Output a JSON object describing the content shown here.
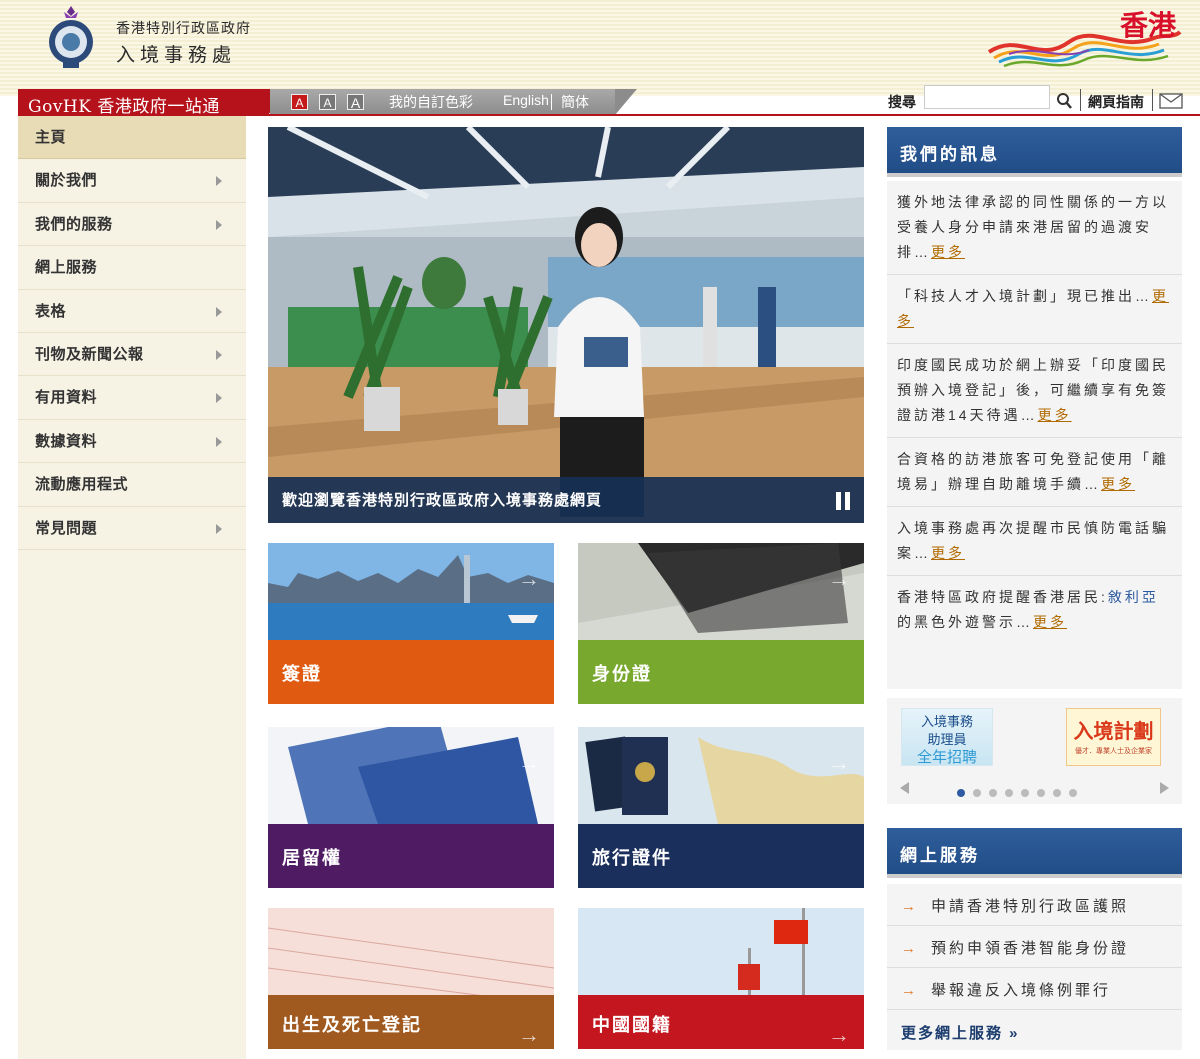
{
  "header": {
    "dept_line1": "香港特別行政區政府",
    "dept_line2": "入境事務處",
    "brand_text": "香港"
  },
  "topnav": {
    "govhk": "GovHK 香港政府一站通",
    "font_sizes": [
      "A",
      "A",
      "A"
    ],
    "color_link": "我的自訂色彩",
    "english": "English",
    "simplified": "簡体",
    "search_label": "搜尋",
    "search_placeholder": "",
    "sitemap": "網頁指南"
  },
  "sidebar": {
    "items": [
      {
        "label": "主頁",
        "active": true,
        "submenu": false
      },
      {
        "label": "關於我們",
        "active": false,
        "submenu": true
      },
      {
        "label": "我們的服務",
        "active": false,
        "submenu": true
      },
      {
        "label": "網上服務",
        "active": false,
        "submenu": false
      },
      {
        "label": "表格",
        "active": false,
        "submenu": true
      },
      {
        "label": "刊物及新聞公報",
        "active": false,
        "submenu": true
      },
      {
        "label": "有用資料",
        "active": false,
        "submenu": true
      },
      {
        "label": "數據資料",
        "active": false,
        "submenu": true
      },
      {
        "label": "流動應用程式",
        "active": false,
        "submenu": false
      },
      {
        "label": "常見問題",
        "active": false,
        "submenu": true
      }
    ]
  },
  "hero": {
    "caption": "歡迎瀏覽香港特別行政區政府入境事務處網頁"
  },
  "tiles": [
    {
      "label": "簽證",
      "color": "#e05a12"
    },
    {
      "label": "身份證",
      "color": "#78a82e"
    },
    {
      "label": "居留權",
      "color": "#4f1b62"
    },
    {
      "label": "旅行證件",
      "color": "#1b2f5c"
    },
    {
      "label": "出生及死亡登記",
      "color": "#a0591e"
    },
    {
      "label": "中國國籍",
      "color": "#c4161e"
    }
  ],
  "news": {
    "title": "我們的訊息",
    "items": [
      {
        "text": "獲外地法律承認的同性關係的一方以受養人身分申請來港居留的過渡安排…",
        "more": "更多"
      },
      {
        "text": "「科技人才入境計劃」現已推出…",
        "more": "更多"
      },
      {
        "text": "印度國民成功於網上辦妥「印度國民預辦入境登記」後，可繼續享有免簽證訪港14天待遇…",
        "more": "更多"
      },
      {
        "text": "合資格的訪港旅客可免登記使用「離境易」辦理自助離境手續…",
        "more": "更多"
      },
      {
        "text": "入境事務處再次提醒市民慎防電話騙案…",
        "more": "更多"
      },
      {
        "text": "香港特區政府提醒香港居民:",
        "link": "敘利亞",
        "text2": "的黑色外遊警示…",
        "more": "更多"
      }
    ]
  },
  "carousel": {
    "banner1_l1": "入境事務",
    "banner1_l2": "助理員",
    "banner1_l3": "全年招聘",
    "banner2_big": "入境計劃",
    "banner2_small": "優才．專業人士及企業家",
    "dots": 8,
    "active_dot": 0
  },
  "services": {
    "title": "網上服務",
    "items": [
      "申請香港特別行政區護照",
      "預約申領香港智能身份證",
      "舉報違反入境條例罪行"
    ],
    "more": "更多網上服務 »"
  },
  "colors": {
    "accent_red": "#b5121b",
    "panel_blue": "#2f5e9b",
    "sidebar_bg": "#f6f3e5"
  }
}
